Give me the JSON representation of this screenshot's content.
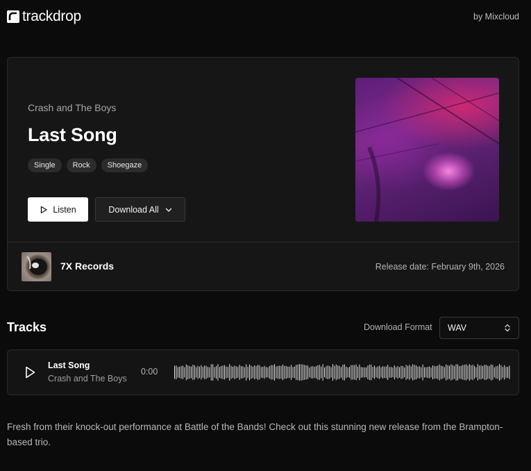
{
  "header": {
    "brand": "trackdrop",
    "by": "by Mixcloud"
  },
  "release": {
    "artist": "Crash and The Boys",
    "title": "Last Song",
    "tags": [
      "Single",
      "Rock",
      "Shoegaze"
    ],
    "listen_label": "Listen",
    "download_label": "Download All",
    "label_name": "7X Records",
    "release_date": "Release date: February 9th, 2026"
  },
  "tracks": {
    "heading": "Tracks",
    "format_label": "Download Format",
    "format_value": "WAV",
    "items": [
      {
        "title": "Last Song",
        "artist": "Crash and The Boys",
        "time": "0:00"
      }
    ]
  },
  "description": "Fresh from their knock-out performance at Battle of the Bands! Check out this stunning new release from the Brampton-based trio.",
  "icons": {
    "logo": "trackdrop-logo-icon",
    "listen": "play-icon",
    "download": "chevron-down-icon",
    "format": "chevron-up-down-icon",
    "track_play": "play-icon"
  },
  "colors": {
    "background": "#0b0b0b",
    "card": "#161616",
    "primary_button": "#ffffff"
  }
}
